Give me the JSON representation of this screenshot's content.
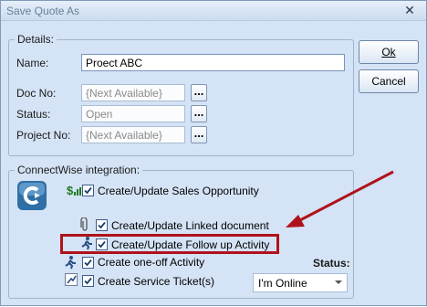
{
  "window": {
    "title": "Save Quote As",
    "close_glyph": "✕"
  },
  "buttons": {
    "ok_label": "Ok",
    "cancel_label": "Cancel"
  },
  "details": {
    "group_label": "Details:",
    "name_label": "Name:",
    "name_value": "Proect ABC",
    "doc_no_label": "Doc No:",
    "doc_no_value": "{Next Available}",
    "status_label": "Status:",
    "status_value": "Open",
    "project_no_label": "Project No:",
    "project_no_value": "{Next Available}",
    "browse_glyph": "..."
  },
  "connectwise": {
    "group_label": "ConnectWise integration:",
    "options": [
      {
        "label": "Create/Update Sales Opportunity",
        "checked": true,
        "icon": "dollar-icon"
      },
      {
        "label": "Create/Update Linked document",
        "checked": true,
        "icon": "paperclip-icon"
      },
      {
        "label": "Create/Update Follow up Activity",
        "checked": true,
        "icon": "running-person-icon"
      },
      {
        "label": "Create one-off Activity",
        "checked": true,
        "icon": "running-person-icon"
      },
      {
        "label": "Create Service Ticket(s)",
        "checked": true,
        "icon": "ticket-icon"
      }
    ],
    "status_label": "Status:",
    "status_value": "I'm Online"
  },
  "annotation": {
    "color": "#b0121b"
  }
}
